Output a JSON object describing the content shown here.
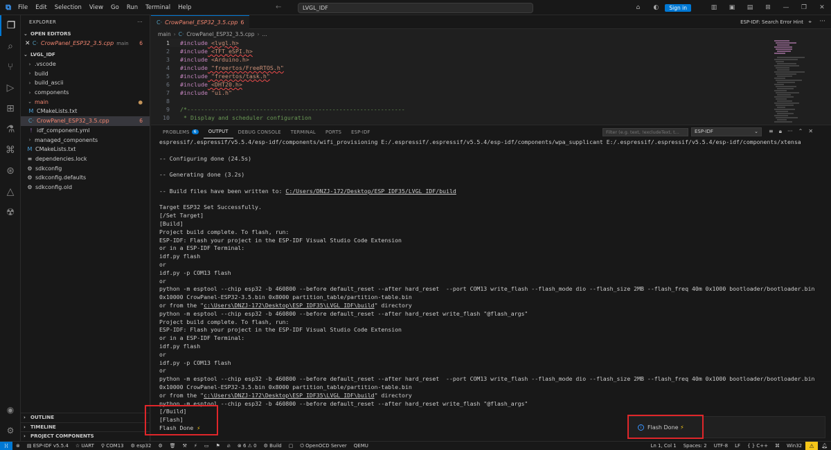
{
  "titlebar": {
    "menu": [
      "File",
      "Edit",
      "Selection",
      "View",
      "Go",
      "Run",
      "Terminal",
      "Help"
    ],
    "search": "LVGL_IDF",
    "sign_in": "Sign in"
  },
  "sidebar": {
    "title": "EXPLORER",
    "more": "···",
    "open_editors": "OPEN EDITORS",
    "open_file": {
      "name": "CrowPanel_ESP32_3.5.cpp",
      "folder": "main",
      "problems": "6"
    },
    "workspace": "LVGL_IDF",
    "tree": [
      {
        "name": ".vscode",
        "type": "folder",
        "depth": 1
      },
      {
        "name": "build",
        "type": "folder",
        "depth": 1
      },
      {
        "name": "build_ascii",
        "type": "folder",
        "depth": 1
      },
      {
        "name": "components",
        "type": "folder",
        "depth": 1
      },
      {
        "name": "main",
        "type": "folder-open",
        "depth": 1,
        "modified": "●"
      },
      {
        "name": "CMakeLists.txt",
        "type": "cmake",
        "depth": 2
      },
      {
        "name": "CrowPanel_ESP32_3.5.cpp",
        "type": "cpp",
        "depth": 2,
        "problems": "6"
      },
      {
        "name": "idf_component.yml",
        "type": "yml",
        "depth": 2
      },
      {
        "name": "managed_components",
        "type": "folder",
        "depth": 1
      },
      {
        "name": "CMakeLists.txt",
        "type": "cmake",
        "depth": 1
      },
      {
        "name": "dependencies.lock",
        "type": "lock",
        "depth": 1
      },
      {
        "name": "sdkconfig",
        "type": "gear",
        "depth": 1
      },
      {
        "name": "sdkconfig.defaults",
        "type": "gear",
        "depth": 1
      },
      {
        "name": "sdkconfig.old",
        "type": "gear",
        "depth": 1
      }
    ],
    "outline": "OUTLINE",
    "timeline": "TIMELINE",
    "project_components": "PROJECT COMPONENTS"
  },
  "editor": {
    "tab_label": "CrowPanel_ESP32_3.5.cpp",
    "tab_problems": "6",
    "hint": "ESP-IDF: Search Error Hint",
    "breadcrumb": [
      "main",
      "CrowPanel_ESP32_3.5.cpp",
      "..."
    ],
    "lines": [
      {
        "n": "1",
        "pre": "#include",
        "arg": " <lvgl.h>",
        "squig": true
      },
      {
        "n": "2",
        "pre": "#include",
        "arg": " <TFT_eSPI.h>",
        "squig": true
      },
      {
        "n": "3",
        "pre": "#include",
        "arg": " <Arduino.h>",
        "squig": false
      },
      {
        "n": "4",
        "pre": "#include",
        "arg": " \"freertos/FreeRTOS.h\"",
        "squig": true
      },
      {
        "n": "5",
        "pre": "#include",
        "arg": " \"freertos/task.h\"",
        "squig": true
      },
      {
        "n": "6",
        "pre": "#include",
        "arg": " <DHT20.h>",
        "squig": true
      },
      {
        "n": "7",
        "pre": "#include",
        "arg": " \"ui.h\"",
        "squig": false
      },
      {
        "n": "8",
        "pre": "",
        "arg": "",
        "squig": false
      },
      {
        "n": "9",
        "pre": "",
        "arg": "/*---------------------------------------------------------------",
        "squig": false
      },
      {
        "n": "10",
        "pre": "",
        "arg": " * Display and scheduler configuration",
        "squig": false
      }
    ]
  },
  "panel": {
    "tabs": [
      {
        "label": "PROBLEMS",
        "count": "6"
      },
      {
        "label": "OUTPUT"
      },
      {
        "label": "DEBUG CONSOLE"
      },
      {
        "label": "TERMINAL"
      },
      {
        "label": "PORTS"
      },
      {
        "label": "ESP-IDF"
      }
    ],
    "filter_placeholder": "Filter (e.g. text, !excludeText, t...",
    "channel": "ESP-IDF",
    "output_lines": [
      "espressif/.espressif/v5.5.4/esp-idf/components/wifi_provisioning E:/.espressif/.espressif/v5.5.4/esp-idf/components/wpa_supplicant E:/.espressif/.espressif/v5.5.4/esp-idf/components/xtensa",
      "",
      "-- Configuring done (24.5s)",
      "",
      "-- Generating done (3.2s)",
      "",
      "-- Build files have been written to: C:/Users/DNZJ-172/Desktop/ESP_IDF35/LVGL_IDF/build",
      "",
      "Target ESP32 Set Successfully.",
      "[/Set Target]",
      "[Build]",
      "Project build complete. To flash, run:",
      "ESP-IDF: Flash your project in the ESP-IDF Visual Studio Code Extension",
      "or in a ESP-IDF Terminal:",
      "idf.py flash",
      "or",
      "idf.py -p COM13 flash",
      "or",
      "python -m esptool --chip esp32 -b 460800 --before default_reset --after hard_reset  --port COM13 write_flash --flash_mode dio --flash_size 2MB --flash_freq 40m 0x1000 bootloader/bootloader.bin",
      "0x10000 CrowPanel-ESP32-3.5.bin 0x8000 partition_table/partition-table.bin",
      "or from the \"c:\\Users\\DNZJ-172\\Desktop\\ESP_IDF35\\LVGL_IDF\\build\" directory",
      "python -m esptool --chip esp32 -b 460800 --before default_reset --after hard_reset write_flash \"@flash_args\"",
      "Project build complete. To flash, run:",
      "ESP-IDF: Flash your project in the ESP-IDF Visual Studio Code Extension",
      "or in a ESP-IDF Terminal:",
      "idf.py flash",
      "or",
      "idf.py -p COM13 flash",
      "or",
      "python -m esptool --chip esp32 -b 460800 --before default_reset --after hard_reset  --port COM13 write_flash --flash_mode dio --flash_size 2MB --flash_freq 40m 0x1000 bootloader/bootloader.bin",
      "0x10000 CrowPanel-ESP32-3.5.bin 0x8000 partition_table/partition-table.bin",
      "or from the \"c:\\Users\\DNZJ-172\\Desktop\\ESP_IDF35\\LVGL_IDF\\build\" directory",
      "python -m esptool --chip esp32 -b 460800 --before default_reset --after hard_reset write_flash \"@flash_args\"",
      "[/Build]",
      "[Flash]",
      "Flash Done ⚡"
    ],
    "notification": "Flash Done ⚡"
  },
  "status": {
    "idf_version": "ESP-IDF v5.5.4",
    "uart": "UART",
    "port": "COM13",
    "target": "esp32",
    "errors": "6",
    "warnings": "0",
    "build": "Build",
    "openocd": "OpenOCD Server",
    "qemu": "QEMU",
    "cursor": "Ln 1, Col 1",
    "spaces": "Spaces: 2",
    "encoding": "UTF-8",
    "eol": "LF",
    "lang": "C++",
    "platform": "Win32"
  }
}
